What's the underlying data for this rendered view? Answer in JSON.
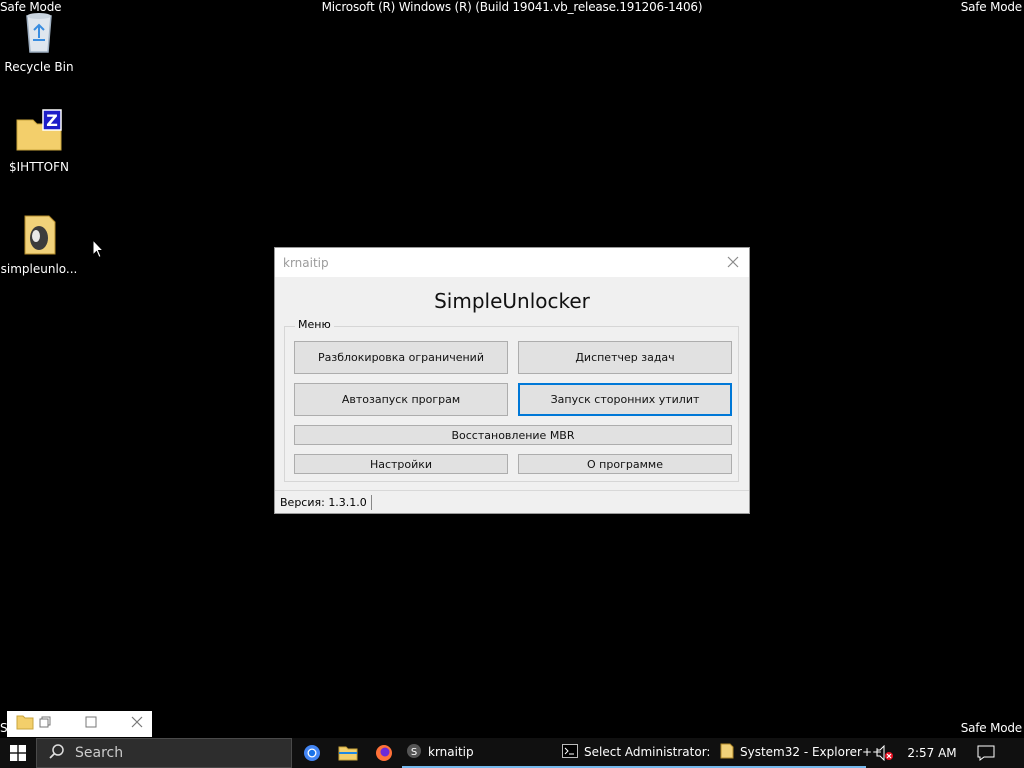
{
  "system": {
    "safe_mode": "Safe Mode",
    "safe_mode_partial": "S",
    "build": "Microsoft (R) Windows (R) (Build 19041.vb_release.191206-1406)"
  },
  "desktop": {
    "icons": [
      {
        "label": "Recycle Bin",
        "icon": "recycle-bin-icon"
      },
      {
        "label": "$IHTTOFN",
        "icon": "zip-folder-icon"
      },
      {
        "label": "simpleunlo...",
        "icon": "archive-file-icon"
      }
    ]
  },
  "dialog": {
    "window_title": "krnaitip",
    "app_title": "SimpleUnlocker",
    "group_label": "Меню",
    "buttons": {
      "unlock": "Разблокировка ограничений",
      "task_manager": "Диспетчер задач",
      "autorun": "Автозапуск програм",
      "launch_utils": "Запуск сторонних утилит",
      "mbr": "Восстановление MBR",
      "settings": "Настройки",
      "about": "О программе"
    },
    "status": "Версия: 1.3.1.0"
  },
  "taskbar": {
    "search_placeholder": "Search",
    "tasks": [
      {
        "label": "krnaitip",
        "icon": "simpleunlocker-icon"
      },
      {
        "label": "Select Administrator: ...",
        "icon": "cmd-icon"
      },
      {
        "label": "System32 - Explorer++",
        "icon": "explorer-plus-icon"
      }
    ],
    "time": "2:57 AM",
    "colors": {
      "taskbar_bg": "#101010",
      "active_underline": "#76b9ed"
    }
  }
}
